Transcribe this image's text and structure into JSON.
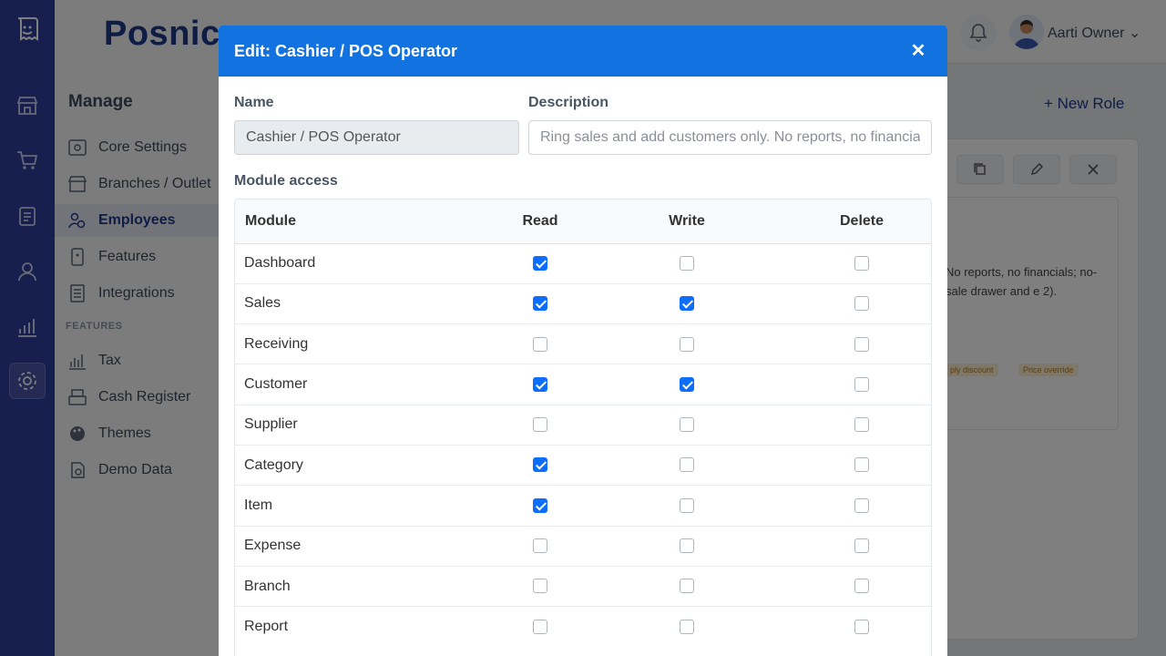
{
  "app": {
    "brand": "Posnic"
  },
  "sidebar": {
    "title": "Manage",
    "items": [
      {
        "label": "Core Settings",
        "icon": "gear-cog-icon"
      },
      {
        "label": "Branches / Outlet",
        "icon": "store-icon"
      },
      {
        "label": "Employees",
        "icon": "employees-gear-icon",
        "active": true
      },
      {
        "label": "Features",
        "icon": "features-icon"
      },
      {
        "label": "Integrations",
        "icon": "integrations-icon"
      }
    ],
    "section_label": "FEATURES",
    "feature_items": [
      {
        "label": "Tax",
        "icon": "tax-chart-icon"
      },
      {
        "label": "Cash Register",
        "icon": "cash-register-icon"
      },
      {
        "label": "Themes",
        "icon": "palette-icon"
      },
      {
        "label": "Demo Data",
        "icon": "demo-data-icon"
      }
    ]
  },
  "header": {
    "user_name": "Aarti Owner"
  },
  "background": {
    "new_role_label": "+ New Role",
    "role_description": "No reports, no financials; no-sale drawer and e 2).",
    "tags": [
      "ply discount",
      "Price override"
    ]
  },
  "modal": {
    "title": "Edit: Cashier / POS Operator",
    "name_label": "Name",
    "name_value": "Cashier / POS Operator",
    "description_label": "Description",
    "description_placeholder": "Ring sales and add customers only. No reports, no financial",
    "module_access_label": "Module access",
    "columns": [
      "Module",
      "Read",
      "Write",
      "Delete"
    ],
    "rows": [
      {
        "module": "Dashboard",
        "read": true,
        "write": false,
        "delete": false
      },
      {
        "module": "Sales",
        "read": true,
        "write": true,
        "delete": false
      },
      {
        "module": "Receiving",
        "read": false,
        "write": false,
        "delete": false
      },
      {
        "module": "Customer",
        "read": true,
        "write": true,
        "delete": false
      },
      {
        "module": "Supplier",
        "read": false,
        "write": false,
        "delete": false
      },
      {
        "module": "Category",
        "read": true,
        "write": false,
        "delete": false
      },
      {
        "module": "Item",
        "read": true,
        "write": false,
        "delete": false
      },
      {
        "module": "Expense",
        "read": false,
        "write": false,
        "delete": false
      },
      {
        "module": "Branch",
        "read": false,
        "write": false,
        "delete": false
      },
      {
        "module": "Report",
        "read": false,
        "write": false,
        "delete": false
      }
    ]
  },
  "colors": {
    "rail": "#2f3e9e",
    "modal_header": "#1273e0",
    "checkbox_checked": "#0d6efd"
  }
}
